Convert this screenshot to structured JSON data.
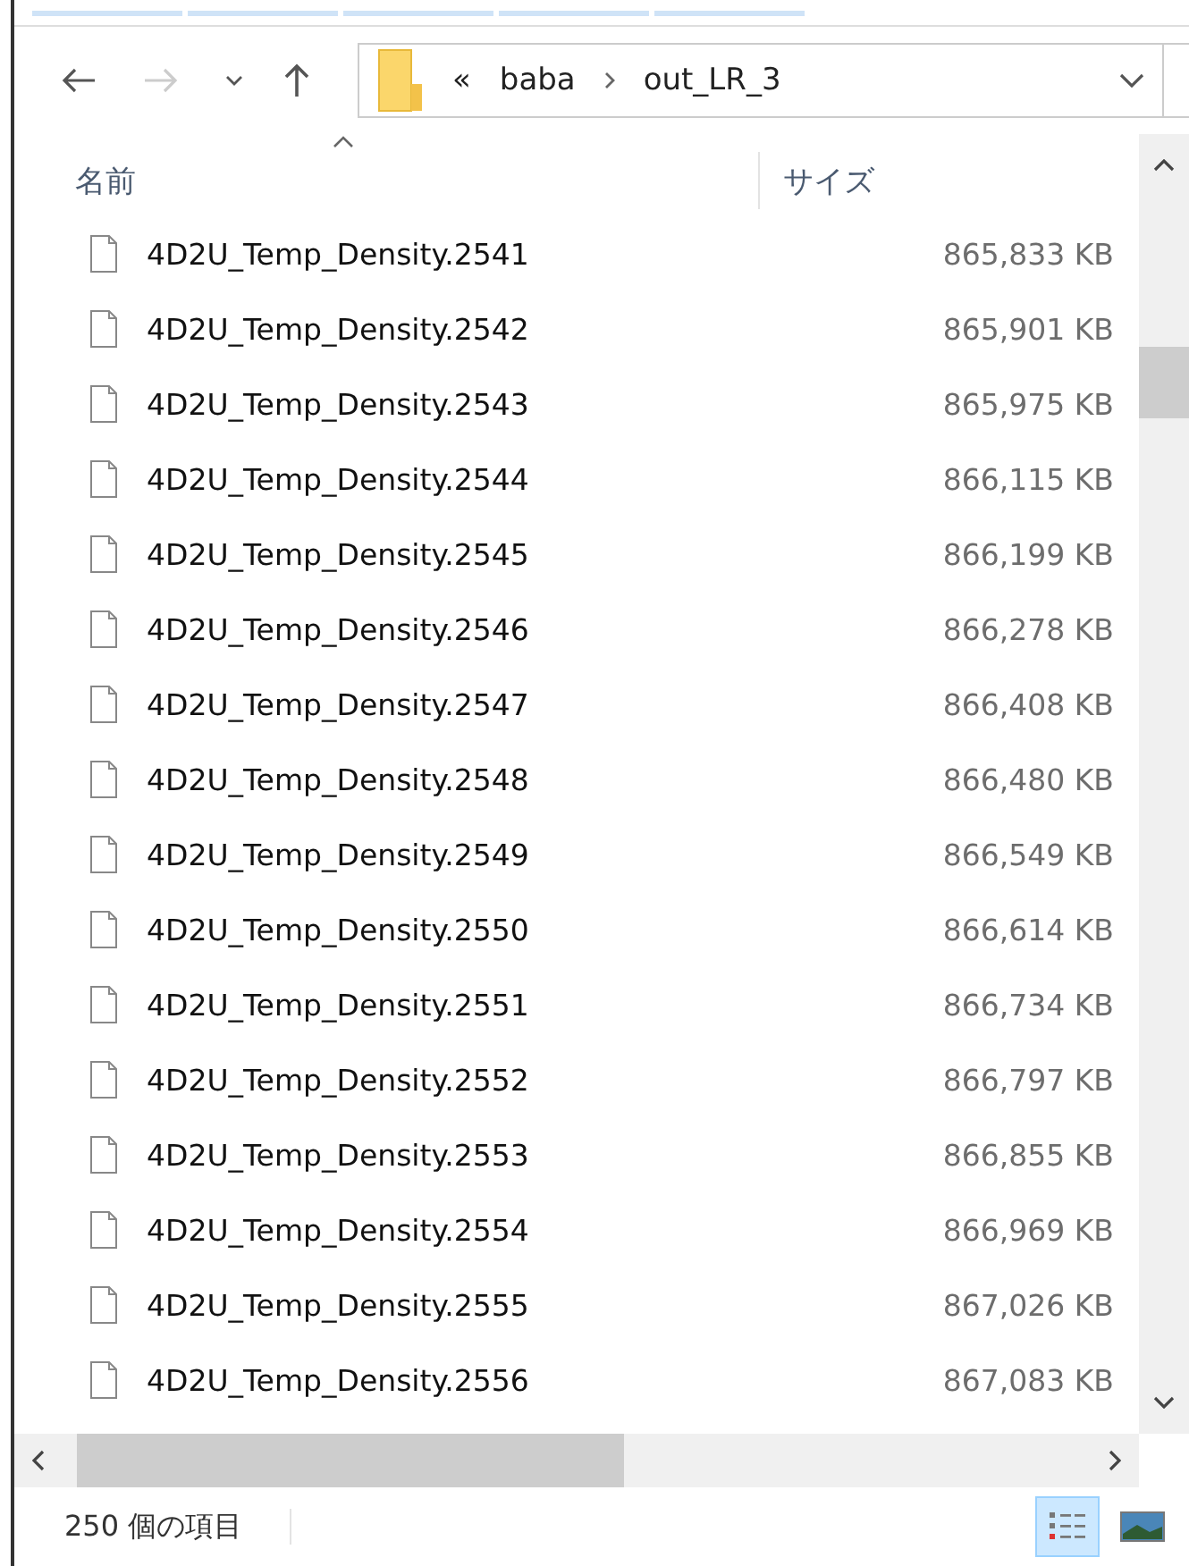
{
  "path": {
    "overflow": "«",
    "segments": [
      "baba",
      "out_LR_3"
    ]
  },
  "columns": [
    {
      "label": "名前",
      "sorted": true
    },
    {
      "label": "サイズ",
      "sorted": false
    }
  ],
  "files": [
    {
      "name": "4D2U_Temp_Density.2541",
      "size": "865,833 KB"
    },
    {
      "name": "4D2U_Temp_Density.2542",
      "size": "865,901 KB"
    },
    {
      "name": "4D2U_Temp_Density.2543",
      "size": "865,975 KB"
    },
    {
      "name": "4D2U_Temp_Density.2544",
      "size": "866,115 KB"
    },
    {
      "name": "4D2U_Temp_Density.2545",
      "size": "866,199 KB"
    },
    {
      "name": "4D2U_Temp_Density.2546",
      "size": "866,278 KB"
    },
    {
      "name": "4D2U_Temp_Density.2547",
      "size": "866,408 KB"
    },
    {
      "name": "4D2U_Temp_Density.2548",
      "size": "866,480 KB"
    },
    {
      "name": "4D2U_Temp_Density.2549",
      "size": "866,549 KB"
    },
    {
      "name": "4D2U_Temp_Density.2550",
      "size": "866,614 KB"
    },
    {
      "name": "4D2U_Temp_Density.2551",
      "size": "866,734 KB"
    },
    {
      "name": "4D2U_Temp_Density.2552",
      "size": "866,797 KB"
    },
    {
      "name": "4D2U_Temp_Density.2553",
      "size": "866,855 KB"
    },
    {
      "name": "4D2U_Temp_Density.2554",
      "size": "866,969 KB"
    },
    {
      "name": "4D2U_Temp_Density.2555",
      "size": "867,026 KB"
    },
    {
      "name": "4D2U_Temp_Density.2556",
      "size": "867,083 KB"
    }
  ],
  "status": {
    "count": "250 個の項目"
  },
  "views": [
    {
      "kind": "details",
      "selected": true
    },
    {
      "kind": "thumbnails",
      "selected": false
    }
  ]
}
